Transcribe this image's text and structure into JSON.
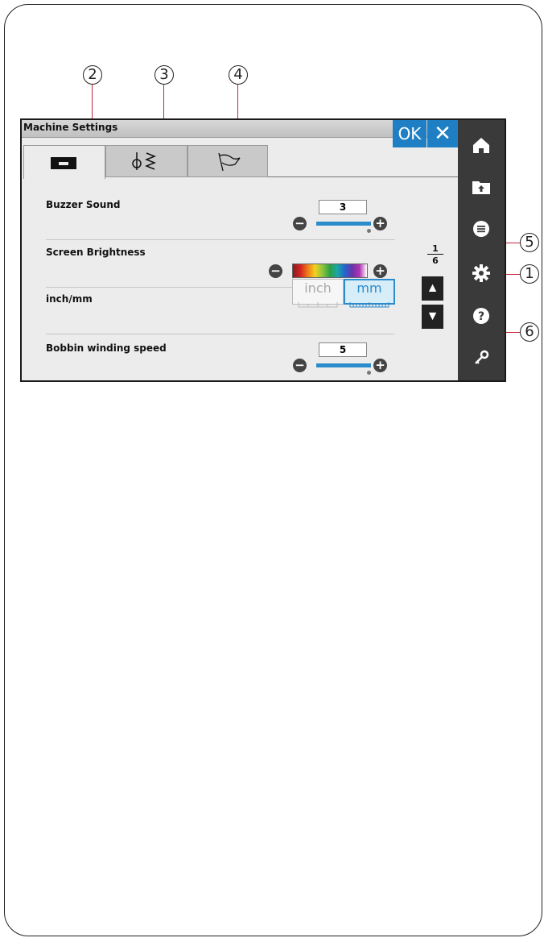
{
  "callouts": {
    "c1": "1",
    "c2": "2",
    "c3": "3",
    "c4": "4",
    "c5": "5",
    "c6": "6"
  },
  "screen": {
    "title": "Machine Settings",
    "ok_label": "OK",
    "close_icon": "close-icon",
    "tabs": [
      {
        "icon": "sewing-machine-icon",
        "active": true
      },
      {
        "icon": "needle-zigzag-icon",
        "active": false
      },
      {
        "icon": "flag-icon",
        "active": false
      }
    ],
    "sidebar": [
      {
        "icon": "home-icon"
      },
      {
        "icon": "folder-upload-icon"
      },
      {
        "icon": "menu-list-icon"
      },
      {
        "icon": "gear-icon"
      },
      {
        "icon": "help-icon"
      },
      {
        "icon": "key-icon"
      }
    ],
    "settings": {
      "buzzer": {
        "label": "Buzzer Sound",
        "value": "3"
      },
      "brightness": {
        "label": "Screen Brightness"
      },
      "units": {
        "label": "inch/mm",
        "inch_label": "inch",
        "mm_label": "mm",
        "selected": "mm"
      },
      "bobbin": {
        "label": "Bobbin winding speed",
        "value": "5"
      }
    },
    "pagination": {
      "current": "1",
      "total": "6"
    }
  },
  "colors": {
    "accent_blue": "#1f7fc4",
    "sidebar_dark": "#3a3a3a",
    "callout_line": "#c8253a"
  }
}
